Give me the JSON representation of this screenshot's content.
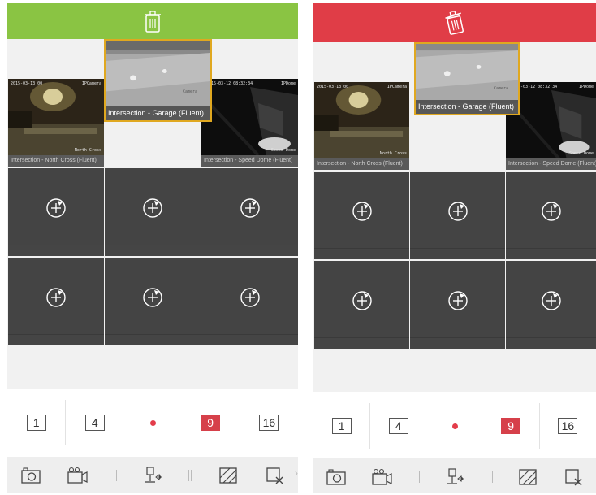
{
  "colors": {
    "trash_bar_left": "#8ac443",
    "trash_bar_right": "#e03d47",
    "active_layout": "#d6404a",
    "drag_border": "#e0a820"
  },
  "trash_icon": "trash-icon",
  "cameras": {
    "north_cross": {
      "caption": "Intersection - North Cross (Fluent)",
      "osd_time": "2015-03-13 00 ",
      "osd_channel": "IPCamera",
      "osd_name": "North Cross"
    },
    "garage": {
      "caption": "Intersection - Garage (Fluent)",
      "osd_channel": "Camera"
    },
    "speed_dome": {
      "caption": "Intersection - Speed Dome (Fluent)",
      "osd_time": "2015-03-12 08:32:34",
      "osd_channel": "IPDome",
      "osd_name": "Speed Dome"
    }
  },
  "empty_cell_icon": "add-circle-icon",
  "layout_options": [
    "1",
    "4",
    "9",
    "16"
  ],
  "layout_active": "9",
  "toolbar_icons": [
    "camera-icon",
    "video-record-icon",
    "ptz-icon",
    "image-adjust-icon",
    "close-window-icon"
  ],
  "more_arrow": "›"
}
